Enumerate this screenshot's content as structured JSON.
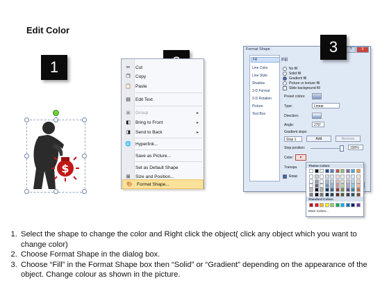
{
  "title": "Edit Color",
  "steps": [
    "1",
    "2",
    "3"
  ],
  "context_menu": {
    "items": [
      {
        "label": "Cut",
        "icon": "scissors-icon",
        "disabled": false,
        "submenu": false,
        "highlight": false
      },
      {
        "label": "Copy",
        "icon": "copy-icon",
        "disabled": false,
        "submenu": false,
        "highlight": false
      },
      {
        "label": "Paste",
        "icon": "paste-icon",
        "disabled": false,
        "submenu": false,
        "highlight": false
      },
      {
        "label": "Edit Text",
        "icon": "edit-text-icon",
        "disabled": false,
        "submenu": false,
        "highlight": false
      },
      {
        "label": "Group",
        "icon": "group-icon",
        "disabled": true,
        "submenu": true,
        "highlight": false
      },
      {
        "label": "Bring to Front",
        "icon": "bring-front-icon",
        "disabled": false,
        "submenu": true,
        "highlight": false
      },
      {
        "label": "Send to Back",
        "icon": "send-back-icon",
        "disabled": false,
        "submenu": true,
        "highlight": false
      },
      {
        "label": "Hyperlink...",
        "icon": "hyperlink-icon",
        "disabled": false,
        "submenu": false,
        "highlight": false
      },
      {
        "label": "Save as Picture...",
        "icon": "",
        "disabled": false,
        "submenu": false,
        "highlight": false
      },
      {
        "label": "Set as Default Shape",
        "icon": "",
        "disabled": false,
        "submenu": false,
        "highlight": false
      },
      {
        "label": "Size and Position...",
        "icon": "size-position-icon",
        "disabled": false,
        "submenu": false,
        "highlight": false
      },
      {
        "label": "Format Shape...",
        "icon": "format-shape-icon",
        "disabled": false,
        "submenu": false,
        "highlight": true
      }
    ]
  },
  "dialog": {
    "title": "Format Shape",
    "categories": [
      "Fill",
      "Line Color",
      "Line Style",
      "Shadow",
      "3-D Format",
      "3-D Rotation",
      "Picture",
      "Text Box"
    ],
    "selected_category": "Fill",
    "heading": "Fill",
    "options": [
      {
        "label": "No fill",
        "type": "radio",
        "checked": false
      },
      {
        "label": "Solid fill",
        "type": "radio",
        "checked": false
      },
      {
        "label": "Gradient fill",
        "type": "radio",
        "checked": true
      },
      {
        "label": "Picture or texture fill",
        "type": "radio",
        "checked": false
      },
      {
        "label": "Slide background fill",
        "type": "check",
        "checked": false
      }
    ],
    "preset_colors_label": "Preset colors:",
    "type_label": "Type:",
    "type_value": "Linear",
    "direction_label": "Direction:",
    "angle_label": "Angle:",
    "angle_value": "270°",
    "gradient_stops_label": "Gradient stops",
    "stop_value": "Stop 1",
    "add_label": "Add",
    "remove_label": "Remove",
    "stop_position_label": "Stop position:",
    "stop_position_value": "100%",
    "color_label": "Color:",
    "transparency_label": "Transpa",
    "rotate_label": "Rotat",
    "close_label": "ose",
    "window_buttons": [
      "?",
      "X"
    ]
  },
  "palette": {
    "theme_header": "Theme Colors",
    "standard_header": "Standard Colors",
    "more_label": "More Colors...",
    "theme_top": [
      "#ffffff",
      "#000000",
      "#eeece1",
      "#1f497d",
      "#4f81bd",
      "#c0504d",
      "#9bbb59",
      "#8064a2",
      "#4bacc6",
      "#f79646"
    ],
    "standard": [
      "#c00000",
      "#ff0000",
      "#ffc000",
      "#ffff00",
      "#92d050",
      "#00b050",
      "#00b0f0",
      "#0070c0",
      "#002060",
      "#7030a0"
    ]
  },
  "instructions": [
    "Select the shape to change the color and Right click the object( click any object which you want to change color)",
    "Choose Format Shape in the dialog box.",
    "Choose “Fill” in the Format Shape box then “Solid” or “Gradient” depending on the appearance of the object. Change colour as shown in the picture."
  ]
}
